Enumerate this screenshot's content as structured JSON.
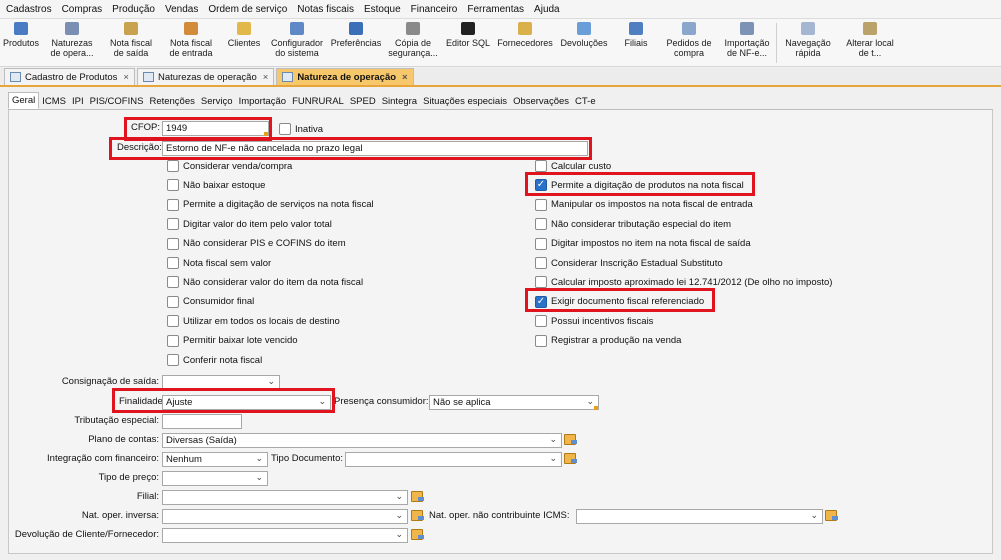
{
  "menu": [
    "Cadastros",
    "Compras",
    "Produção",
    "Vendas",
    "Ordem de serviço",
    "Notas fiscais",
    "Estoque",
    "Financeiro",
    "Ferramentas",
    "Ajuda"
  ],
  "toolbar": [
    {
      "label": "Produtos",
      "icon": "products-icon",
      "color": "#4a7cc4",
      "w": 42
    },
    {
      "label": "Naturezas\nde opera...",
      "icon": "nature-icon",
      "color": "#7b8fb3",
      "w": 60
    },
    {
      "label": "Nota fiscal\nde saída",
      "icon": "invoice-out-icon",
      "color": "#c9a24f",
      "w": 58
    },
    {
      "label": "Nota fiscal\nde entrada",
      "icon": "invoice-in-icon",
      "color": "#d28a3b",
      "w": 62
    },
    {
      "label": "Clientes",
      "icon": "clients-icon",
      "color": "#e3b84a",
      "w": 44
    },
    {
      "label": "Configurador\ndo sistema",
      "icon": "settings-icon",
      "color": "#5f88c6",
      "w": 62
    },
    {
      "label": "Preferências",
      "icon": "preferences-icon",
      "color": "#3b6fb8",
      "w": 56
    },
    {
      "label": "Cópia de\nsegurança...",
      "icon": "backup-icon",
      "color": "#8a8a8a",
      "w": 58
    },
    {
      "label": "Editor SQL",
      "icon": "sql-icon",
      "color": "#222222",
      "w": 52
    },
    {
      "label": "Fornecedores",
      "icon": "suppliers-icon",
      "color": "#d9b04a",
      "w": 62
    },
    {
      "label": "Devoluções",
      "icon": "returns-icon",
      "color": "#6a9ed8",
      "w": 56
    },
    {
      "label": "Filiais",
      "icon": "branches-icon",
      "color": "#4f7fc0",
      "w": 48
    },
    {
      "label": "Pedidos de\ncompra",
      "icon": "purchase-orders-icon",
      "color": "#8ba6cc",
      "w": 58
    },
    {
      "label": "Importação\nde NF-e...",
      "icon": "import-nfe-icon",
      "color": "#7d93b5",
      "w": 58
    },
    {
      "label": "Navegação\nrápida",
      "icon": "quick-nav-icon",
      "color": "#a4b6d0",
      "w": 62
    },
    {
      "label": "Alterar local\nde t...",
      "icon": "change-location-icon",
      "color": "#b9a36a",
      "w": 62
    }
  ],
  "doc_tabs": [
    {
      "label": "Cadastro de Produtos",
      "active": false
    },
    {
      "label": "Naturezas de operação",
      "active": false
    },
    {
      "label": "Natureza de operação",
      "active": true
    }
  ],
  "sub_tabs": [
    "Geral",
    "ICMS",
    "IPI",
    "PIS/COFINS",
    "Retenções",
    "Serviço",
    "Importação",
    "FUNRURAL",
    "SPED",
    "Sintegra",
    "Situações especiais",
    "Observações",
    "CT-e"
  ],
  "form": {
    "cfop_label": "CFOP:",
    "cfop_value": "1949",
    "inativa_label": "Inativa",
    "descricao_label": "Descrição:",
    "descricao_value": "Estorno de NF-e não cancelada no prazo legal",
    "left_checks": [
      {
        "label": "Considerar venda/compra",
        "checked": false
      },
      {
        "label": "Não baixar estoque",
        "checked": false
      },
      {
        "label": "Permite a digitação de serviços na nota fiscal",
        "checked": false
      },
      {
        "label": "Digitar valor do item pelo valor total",
        "checked": false
      },
      {
        "label": "Não considerar PIS e COFINS do item",
        "checked": false
      },
      {
        "label": "Nota fiscal sem valor",
        "checked": false
      },
      {
        "label": "Não considerar valor do item da nota fiscal",
        "checked": false
      },
      {
        "label": "Consumidor final",
        "checked": false
      },
      {
        "label": "Utilizar em todos os locais de destino",
        "checked": false
      },
      {
        "label": "Permitir baixar lote vencido",
        "checked": false
      },
      {
        "label": "Conferir nota fiscal",
        "checked": false
      }
    ],
    "right_checks": [
      {
        "label": "Calcular custo",
        "checked": false
      },
      {
        "label": "Permite a digitação de produtos na nota fiscal",
        "checked": true
      },
      {
        "label": "Manipular os impostos na nota fiscal de entrada",
        "checked": false
      },
      {
        "label": "Não considerar tributação especial do item",
        "checked": false
      },
      {
        "label": "Digitar impostos no item na nota fiscal de saída",
        "checked": false
      },
      {
        "label": "Considerar Inscrição Estadual Substituto",
        "checked": false
      },
      {
        "label": "Calcular imposto aproximado lei 12.741/2012 (De olho no imposto)",
        "checked": false
      },
      {
        "label": "Exigir documento fiscal referenciado",
        "checked": true
      },
      {
        "label": "Possui incentivos fiscais",
        "checked": false
      },
      {
        "label": "Registrar a produção na venda",
        "checked": false
      }
    ],
    "consignacao_label": "Consignação de saída:",
    "consignacao_value": "",
    "finalidade_label": "Finalidade:",
    "finalidade_value": "Ajuste",
    "presenca_label": "Presença consumidor:",
    "presenca_value": "Não se aplica",
    "tributacao_label": "Tributação especial:",
    "plano_label": "Plano de contas:",
    "plano_value": "Diversas (Saída)",
    "integracao_label": "Integração com financeiro:",
    "integracao_value": "Nenhum",
    "tipo_doc_label": "Tipo Documento:",
    "tipo_doc_value": "",
    "tipo_preco_label": "Tipo de preço:",
    "filial_label": "Filial:",
    "nat_inversa_label": "Nat. oper. inversa:",
    "nat_nao_contrib_label": "Nat. oper. não contribuinte ICMS:",
    "devolucao_label": "Devolução de Cliente/Fornecedor:"
  },
  "highlight_color": "#e0141e",
  "accent_color": "#f7c86b"
}
